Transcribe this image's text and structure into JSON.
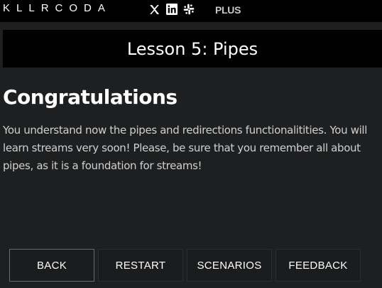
{
  "header": {
    "logo_text": "KLLRCODA",
    "social_icons": [
      "x-icon",
      "linkedin-icon",
      "slack-icon"
    ],
    "plus_label": "PLUS"
  },
  "lesson": {
    "title": "Lesson 5: Pipes"
  },
  "content": {
    "heading": "Congratulations",
    "paragraph": "You understand now the pipes and redirections functionalitities. You will learn streams very soon! Please, be sure that you remember all about pipes, as it is a foundation for streams!"
  },
  "buttons": {
    "back": "BACK",
    "restart": "RESTART",
    "scenarios": "SCENARIOS",
    "feedback": "FEEDBACK"
  },
  "colors": {
    "background": "#1e1f20",
    "bar": "#000000",
    "text": "#ffffff"
  }
}
